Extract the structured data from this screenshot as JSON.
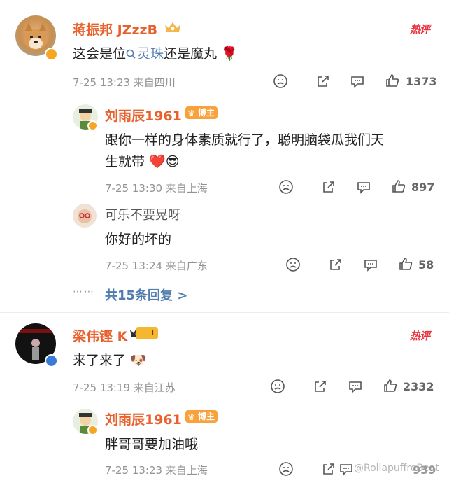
{
  "comments": [
    {
      "user": "蒋振邦 JZzzB",
      "hot_label": "热评",
      "text_before": "这会是位",
      "link_text": "灵珠",
      "text_after": "还是魔丸",
      "emoji": "🌹",
      "meta": "7-25 13:23  来自四川",
      "likes": "1373",
      "replies": [
        {
          "user": "刘雨辰1961",
          "badge": "博主",
          "text_line1": "跟你一样的身体素质就行了，聪明脑袋瓜我们天",
          "text_line2": "生就带",
          "emoji": "❤️😎",
          "meta": "7-25 13:30  来自上海",
          "likes": "897"
        },
        {
          "user": "可乐不要晃呀",
          "text": "你好的坏的",
          "meta": "7-25 13:24  来自广东",
          "likes": "58"
        }
      ],
      "more_replies": "共15条回复 >",
      "dots": "⋯⋯"
    },
    {
      "user": "梁伟铿 K",
      "level_label": "I",
      "hot_label": "热评",
      "text": "来了来了",
      "emoji": "🐶",
      "meta": "7-25 13:19  来自江苏",
      "likes": "2332",
      "replies": [
        {
          "user": "刘雨辰1961",
          "badge": "博主",
          "text": "胖哥哥要加油哦",
          "meta": "7-25 13:23  来自上海",
          "likes": "939"
        }
      ]
    }
  ],
  "watermark": "@RollapuffroBeat",
  "icons": {
    "dislike": "dislike-face-icon",
    "share": "share-icon",
    "comment": "comment-bubble-icon",
    "like": "thumb-up-icon"
  },
  "colors": {
    "username": "#e8612d",
    "link": "#507daf",
    "hot": "#e8323c",
    "meta": "#939393"
  }
}
